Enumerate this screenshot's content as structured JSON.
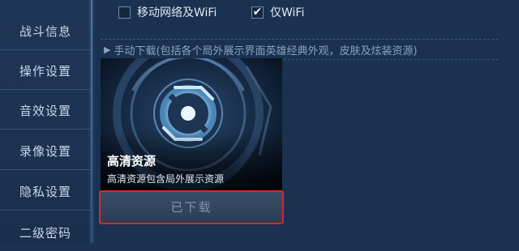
{
  "sidebar": {
    "items": [
      {
        "label": "战斗信息"
      },
      {
        "label": "操作设置"
      },
      {
        "label": "音效设置"
      },
      {
        "label": "录像设置"
      },
      {
        "label": "隐私设置"
      },
      {
        "label": "二级密码"
      }
    ]
  },
  "network_options": [
    {
      "label": "移动网络及WiFi",
      "checked": false
    },
    {
      "label": "仅WiFi",
      "checked": true
    }
  ],
  "download_note": "手动下载(包括各个局外展示界面英雄经典外观，皮肤及炫装资源)",
  "resource_card": {
    "icon": "game-logo-icon",
    "title": "高清资源",
    "description": "高清资源包含局外展示资源"
  },
  "download_button": {
    "label": "已下载",
    "state": "downloaded"
  },
  "colors": {
    "background": "#1b3150",
    "highlight_border": "#e02424",
    "checkbox_check": "#e8f1ff"
  }
}
